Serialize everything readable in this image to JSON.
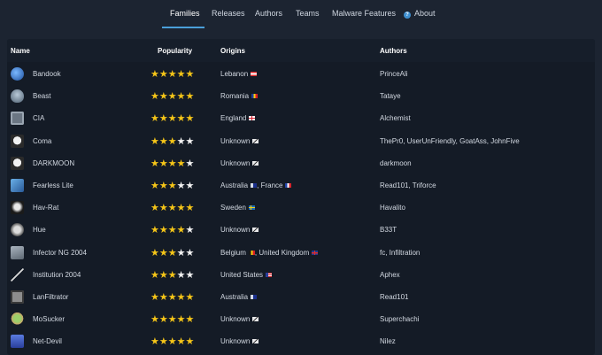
{
  "nav": {
    "items": [
      "Families",
      "Releases",
      "Authors",
      "Teams",
      "Malware Features",
      "About"
    ],
    "active": "Families"
  },
  "table": {
    "headers": [
      "Name",
      "Popularity",
      "Origins",
      "Authors"
    ],
    "rows": [
      {
        "name": "Bandook",
        "icon": "globe-icon",
        "stars": 5,
        "origins": "Lebanon",
        "flags": [
          "lebanon-flag-icon"
        ],
        "authors": "PrinceAli"
      },
      {
        "name": "Beast",
        "icon": "alien-icon",
        "stars": 5,
        "origins": "Romania",
        "flags": [
          "romania-flag-icon"
        ],
        "authors": "Tataye"
      },
      {
        "name": "CIA",
        "icon": "cia-icon",
        "stars": 5,
        "origins": "England",
        "flags": [
          "england-flag-icon"
        ],
        "authors": "Alchemist"
      },
      {
        "name": "Coma",
        "icon": "skull-icon",
        "stars": 3,
        "origins": "Unknown",
        "flags": [
          "unknown-flag-icon"
        ],
        "authors": "ThePr0, UserUnFriendly, GoatAss, JohnFive"
      },
      {
        "name": "DARKMOON",
        "icon": "skull-icon",
        "stars": 4,
        "origins": "Unknown",
        "flags": [
          "unknown-flag-icon"
        ],
        "authors": "darkmoon"
      },
      {
        "name": "Fearless Lite",
        "icon": "fearless-icon",
        "stars": 3,
        "origins": "Australia , France",
        "flags": [
          "australia-flag-icon",
          "france-flag-icon"
        ],
        "authors": "Read101, Triforce"
      },
      {
        "name": "Hav-Rat",
        "icon": "hav-rat-icon",
        "stars": 5,
        "origins": "Sweden",
        "flags": [
          "sweden-flag-icon"
        ],
        "authors": "Havalito"
      },
      {
        "name": "Hue",
        "icon": "hue-icon",
        "stars": 4,
        "origins": "Unknown",
        "flags": [
          "unknown-flag-icon"
        ],
        "authors": "B33T"
      },
      {
        "name": "Infector NG 2004",
        "icon": "infector-icon",
        "stars": 3,
        "origins": "Belgium , United Kingdom",
        "flags": [
          "belgium-flag-icon",
          "uk-flag-icon"
        ],
        "authors": "fc, Infiltration"
      },
      {
        "name": "Institution 2004",
        "icon": "pen-icon",
        "stars": 3,
        "origins": "United States",
        "flags": [
          "usa-flag-icon"
        ],
        "authors": "Aphex"
      },
      {
        "name": "LanFiltrator",
        "icon": "lanfiltrator-icon",
        "stars": 5,
        "origins": "Australia",
        "flags": [
          "australia-flag-icon"
        ],
        "authors": "Read101"
      },
      {
        "name": "MoSucker",
        "icon": "yoda-icon",
        "stars": 5,
        "origins": "Unknown",
        "flags": [
          "unknown-flag-icon"
        ],
        "authors": "Superchachi"
      },
      {
        "name": "Net-Devil",
        "icon": "net-devil-icon",
        "stars": 5,
        "origins": "Unknown",
        "flags": [
          "unknown-flag-icon"
        ],
        "authors": "Nilez"
      }
    ]
  },
  "colors": {
    "background": "#1c2431",
    "table_bg": "#141b26",
    "accent": "#4a9fd9",
    "star": "#f5c518"
  }
}
